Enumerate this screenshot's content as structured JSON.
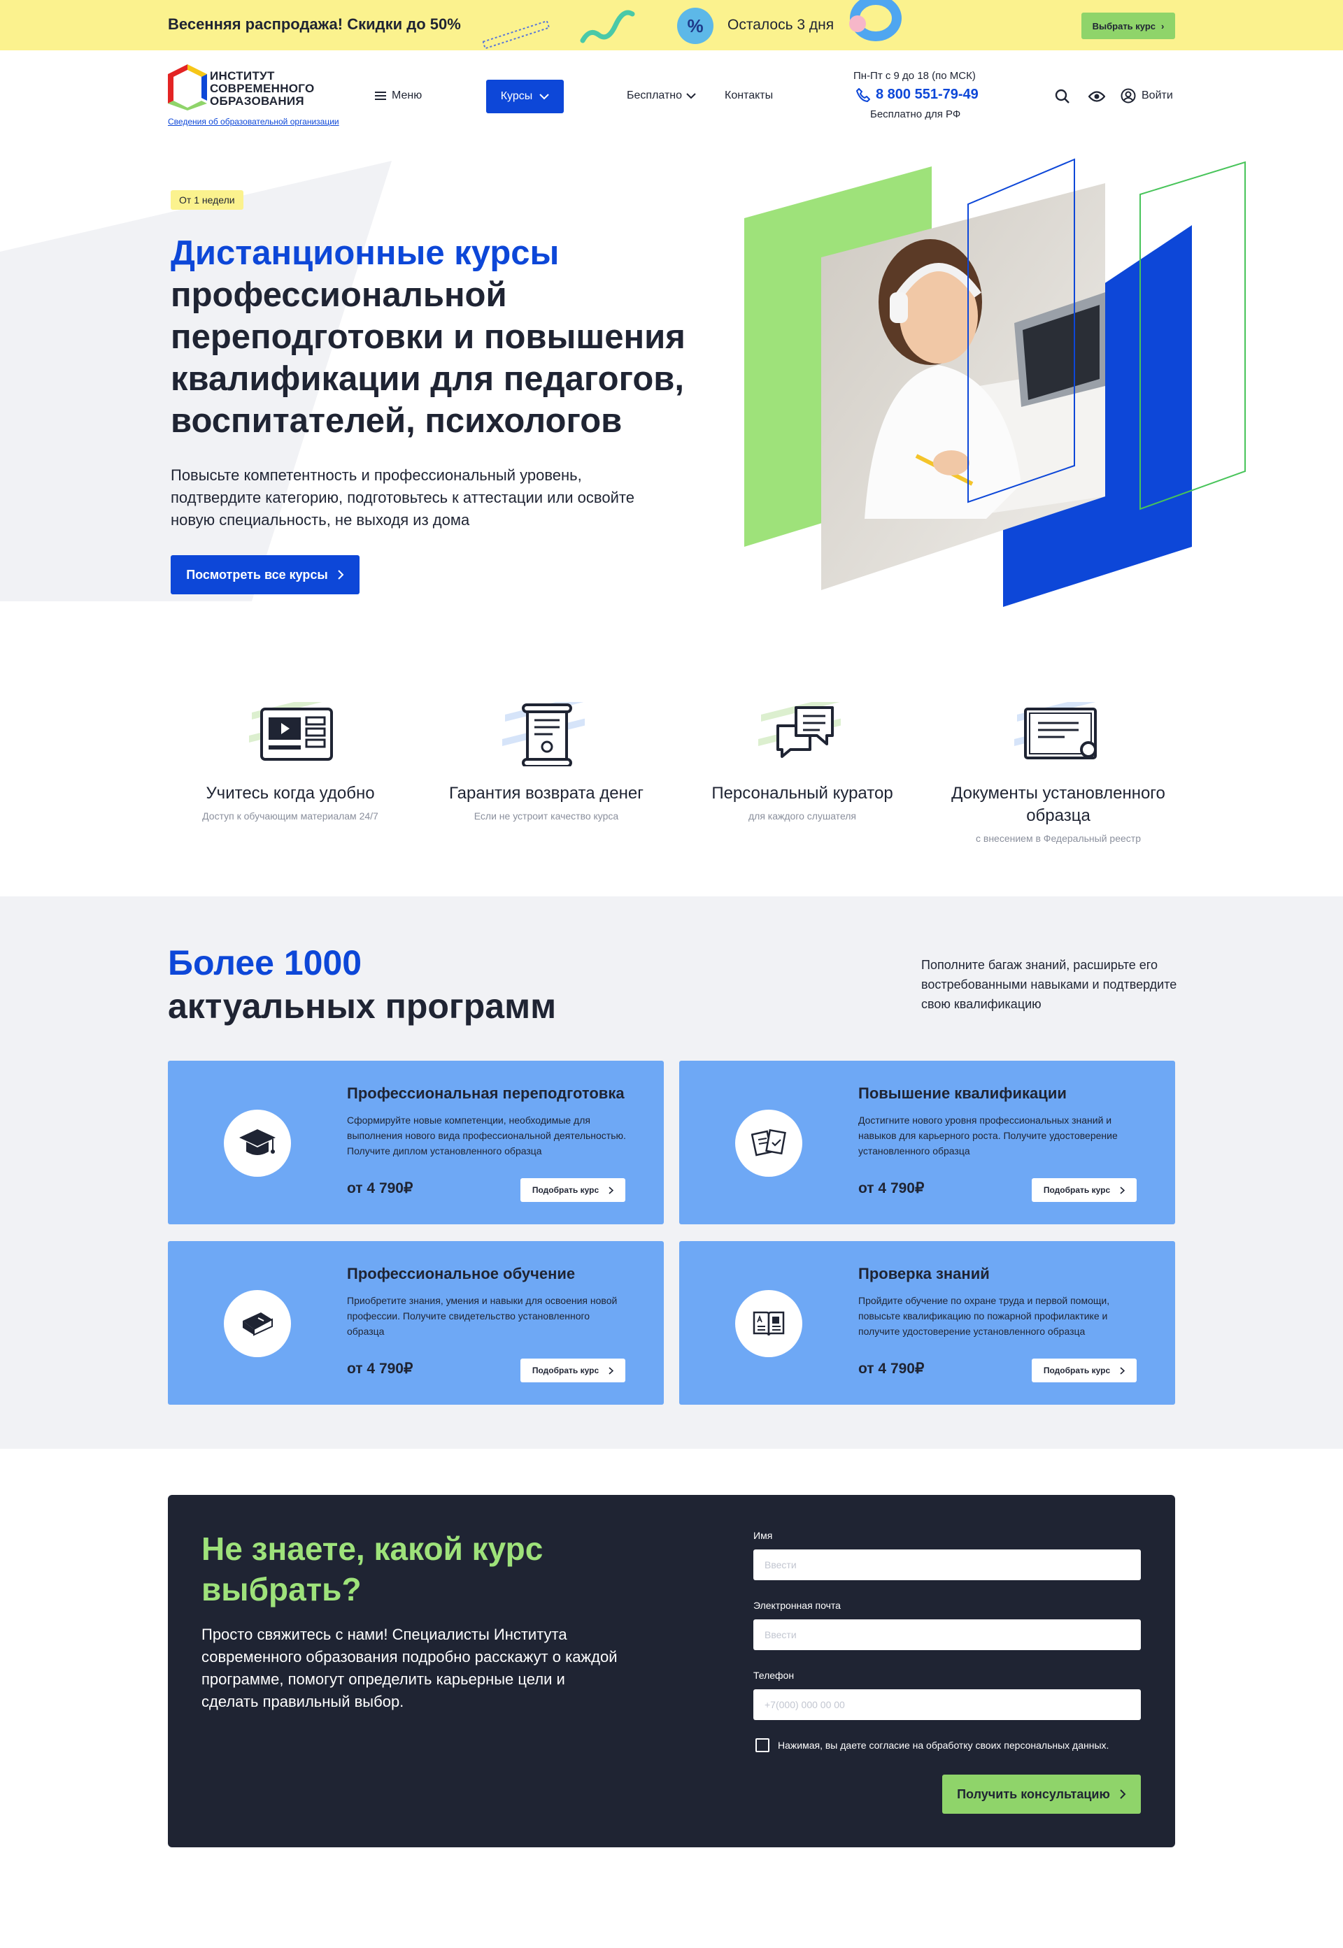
{
  "promo": {
    "text": "Весенняя распродажа! Скидки до 50%",
    "badge": "%",
    "timer": "Осталось 3 дня",
    "button": "Выбрать курс"
  },
  "header": {
    "logo_line1": "Институт",
    "logo_line2": "современного",
    "logo_line3": "образования",
    "logo_sub": "Сведения об образовательной организации",
    "menu": "Меню",
    "courses": "Курсы",
    "free": "Бесплатно",
    "contacts": "Контакты",
    "hours": "Пн-Пт с 9 до 18 (по МСК)",
    "phone": "8 800 551-79-49",
    "phone_note": "Бесплатно для РФ",
    "login": "Войти"
  },
  "hero": {
    "badge": "От 1 недели",
    "title_accent": "Дистанционные курсы",
    "title_rest": "профессиональной переподготовки и повышения квалификации для педагогов, воспитателей, психологов",
    "description": "Повысьте компетентность и профессиональный уровень, подтвердите категорию, подготовьтесь к аттестации или освойте новую специальность, не выходя из дома",
    "button": "Посмотреть все курсы"
  },
  "features": [
    {
      "title": "Учитесь когда удобно",
      "sub": "Доступ к обучающим материалам 24/7",
      "icon": "video-lesson-icon"
    },
    {
      "title": "Гарантия возврата денег",
      "sub": "Если не устроит качество курса",
      "icon": "scroll-certificate-icon"
    },
    {
      "title": "Персональный куратор",
      "sub": "для каждого слушателя",
      "icon": "chat-bubbles-icon"
    },
    {
      "title": "Документы установленного образца",
      "sub": "с внесением в Федеральный реестр",
      "icon": "diploma-icon"
    }
  ],
  "programs": {
    "title_accent": "Более 1000",
    "title_rest": "актуальных программ",
    "description": "Пополните багаж знаний, расширьте его востребованными навыками и подтвердите свою квалификацию",
    "cards": [
      {
        "title": "Профессиональная переподготовка",
        "desc": "Сформируйте новые компетенции, необходимые для выполнения нового вида профессиональной деятельностью. Получите диплом установленного образца",
        "price": "от 4 790₽",
        "button": "Подобрать курс",
        "icon": "graduation-cap-icon"
      },
      {
        "title": "Повышение квалификации",
        "desc": "Достигните нового уровня профессиональных знаний и навыков для карьерного роста. Получите удостоверение установленного образца",
        "price": "от 4 790₽",
        "button": "Подобрать курс",
        "icon": "documents-icon"
      },
      {
        "title": "Профессиональное обучение",
        "desc": "Приобретите знания, умения и навыки для освоения новой профессии. Получите свидетельство установленного образца",
        "price": "от 4 790₽",
        "button": "Подобрать курс",
        "icon": "book-icon"
      },
      {
        "title": "Проверка знаний",
        "desc": "Пройдите обучение по охране труда и первой помощи, повысьте квалификацию по пожарной профилактике и получите удостоверение установленного образца",
        "price": "от 4 790₽",
        "button": "Подобрать курс",
        "icon": "open-book-icon"
      }
    ]
  },
  "consult": {
    "title": "Не знаете, какой курс выбрать?",
    "text": "Просто свяжитесь с нами! Специалисты Института современного образования подробно расскажут о каждой программе, помогут определить карьерные цели и сделать правильный выбор.",
    "name_label": "Имя",
    "name_placeholder": "Ввести",
    "email_label": "Электронная почта",
    "email_placeholder": "Ввести",
    "phone_label": "Телефон",
    "phone_placeholder": "+7(000) 000 00 00",
    "agree": "Нажимая, вы даете согласие на обработку своих персональных данных.",
    "button": "Получить консультацию"
  },
  "colors": {
    "accent": "#0d47d8",
    "green": "#8fd46a",
    "yellow": "#fbf28e",
    "card": "#6ea8f5",
    "dark": "#1f2433"
  }
}
